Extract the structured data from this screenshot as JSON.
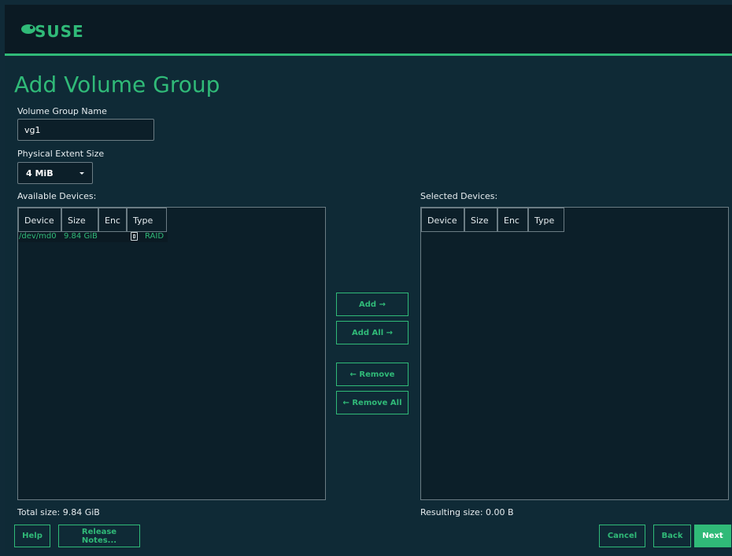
{
  "brand": {
    "logo_text": "SUSE",
    "accent": "#30ba78",
    "bg": "#0f2a36"
  },
  "page": {
    "title": "Add Volume Group"
  },
  "form": {
    "vg_name_label": "Volume Group Name",
    "vg_name_value": "vg1",
    "extent_label": "Physical Extent Size",
    "extent_value": "4 MiB"
  },
  "available": {
    "label": "Available Devices:",
    "columns": [
      "Device",
      "Size",
      "Enc",
      "Type"
    ],
    "rows": [
      {
        "device": "/dev/md0",
        "size": "9.84 GiB",
        "enc": "",
        "type_icon": "raid-icon",
        "type": "RAID"
      }
    ],
    "total": "Total size: 9.84 GiB"
  },
  "selected": {
    "label": "Selected Devices:",
    "columns": [
      "Device",
      "Size",
      "Enc",
      "Type"
    ],
    "rows": [],
    "resulting": "Resulting size: 0.00 B"
  },
  "actions": {
    "add": "Add →",
    "add_all": "Add All →",
    "remove": "← Remove",
    "remove_all": "← Remove All"
  },
  "footer": {
    "help": "Help",
    "release_notes": "Release Notes...",
    "cancel": "Cancel",
    "back": "Back",
    "next": "Next"
  }
}
